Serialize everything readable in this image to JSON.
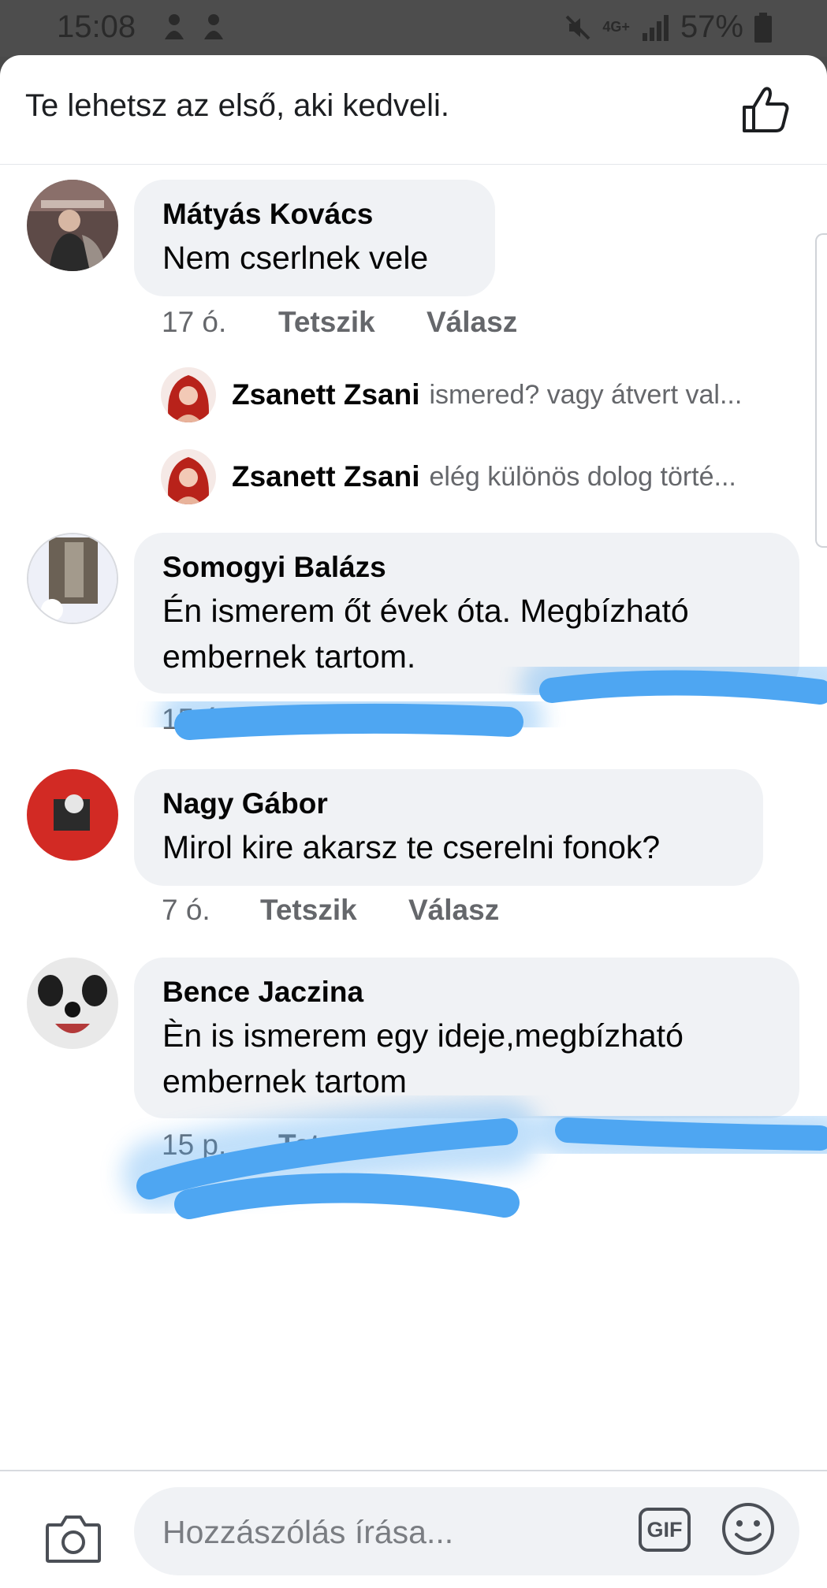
{
  "status_bar": {
    "time": "15:08",
    "network": "4G+",
    "battery": "57%"
  },
  "header": {
    "like_prompt": "Te lehetsz az első, aki kedveli."
  },
  "comments": [
    {
      "author": "Mátyás Kovács",
      "text": "Nem cserlnek vele",
      "time": "17 ó.",
      "like_label": "Tetszik",
      "reply_label": "Válasz",
      "replies": [
        {
          "author": "Zsanett Zsani",
          "preview": "ismered? vagy átvert val..."
        },
        {
          "author": "Zsanett Zsani",
          "preview": "elég különös dolog törté..."
        }
      ]
    },
    {
      "author": "Somogyi Balázs",
      "text_lines": [
        "Én ismerem őt évek óta. Megbízható",
        "embernek tartom."
      ],
      "time": "15 ó."
    },
    {
      "author": "Nagy Gábor",
      "text": "Mirol kire akarsz te cserelni fonok?",
      "time": "7 ó.",
      "like_label": "Tetszik",
      "reply_label": "Válasz"
    },
    {
      "author": "Bence Jaczina",
      "text_lines": [
        "Èn is ismerem egy ideje,megbízható",
        "embernek tartom"
      ],
      "time": "15 p.",
      "like_label_partial": "Tetsz"
    }
  ],
  "composer": {
    "placeholder": "Hozzászólás írása...",
    "gif_label": "GIF"
  },
  "colors": {
    "bubble": "#f0f2f5",
    "scribble": "#4ea6f2",
    "secondary_text": "#65676b"
  }
}
